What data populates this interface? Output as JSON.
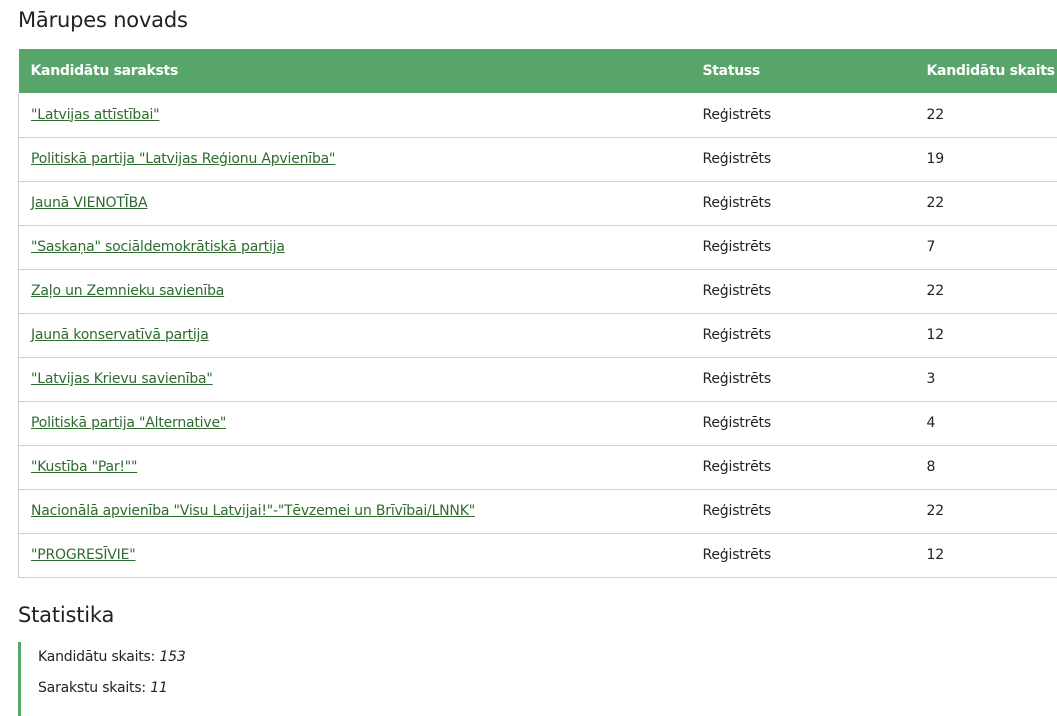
{
  "region": {
    "title": "Mārupes novads"
  },
  "table": {
    "headers": {
      "list": "Kandidātu saraksts",
      "status": "Statuss",
      "count": "Kandidātu skaits"
    },
    "rows": [
      {
        "name": "\"Latvijas attīstībai\"",
        "status": "Reģistrēts",
        "count": "22"
      },
      {
        "name": "Politiskā partija \"Latvijas Reģionu Apvienība\"",
        "status": "Reģistrēts",
        "count": "19"
      },
      {
        "name": "Jaunā VIENOTĪBA",
        "status": "Reģistrēts",
        "count": "22"
      },
      {
        "name": "\"Saskaņa\" sociāldemokrātiskā partija",
        "status": "Reģistrēts",
        "count": "7"
      },
      {
        "name": "Zaļo un Zemnieku savienība",
        "status": "Reģistrēts",
        "count": "22"
      },
      {
        "name": "Jaunā konservatīvā partija",
        "status": "Reģistrēts",
        "count": "12"
      },
      {
        "name": "\"Latvijas Krievu savienība\"",
        "status": "Reģistrēts",
        "count": "3"
      },
      {
        "name": "Politiskā partija \"Alternative\"",
        "status": "Reģistrēts",
        "count": "4"
      },
      {
        "name": "\"Kustība \"Par!\"\"",
        "status": "Reģistrēts",
        "count": "8"
      },
      {
        "name": "Nacionālā apvienība \"Visu Latvijai!\"-\"Tēvzemei un Brīvībai/LNNK\"",
        "status": "Reģistrēts",
        "count": "22"
      },
      {
        "name": "\"PROGRESĪVIE\"",
        "status": "Reģistrēts",
        "count": "12"
      }
    ]
  },
  "statistics": {
    "title": "Statistika",
    "candidates_label": "Kandidātu skaits:",
    "candidates_value": "153",
    "lists_label": "Sarakstu skaits:",
    "lists_value": "11"
  },
  "colors": {
    "header_bg": "#58a56a",
    "link": "#2f6b2f",
    "accent_border": "#58a56a"
  }
}
